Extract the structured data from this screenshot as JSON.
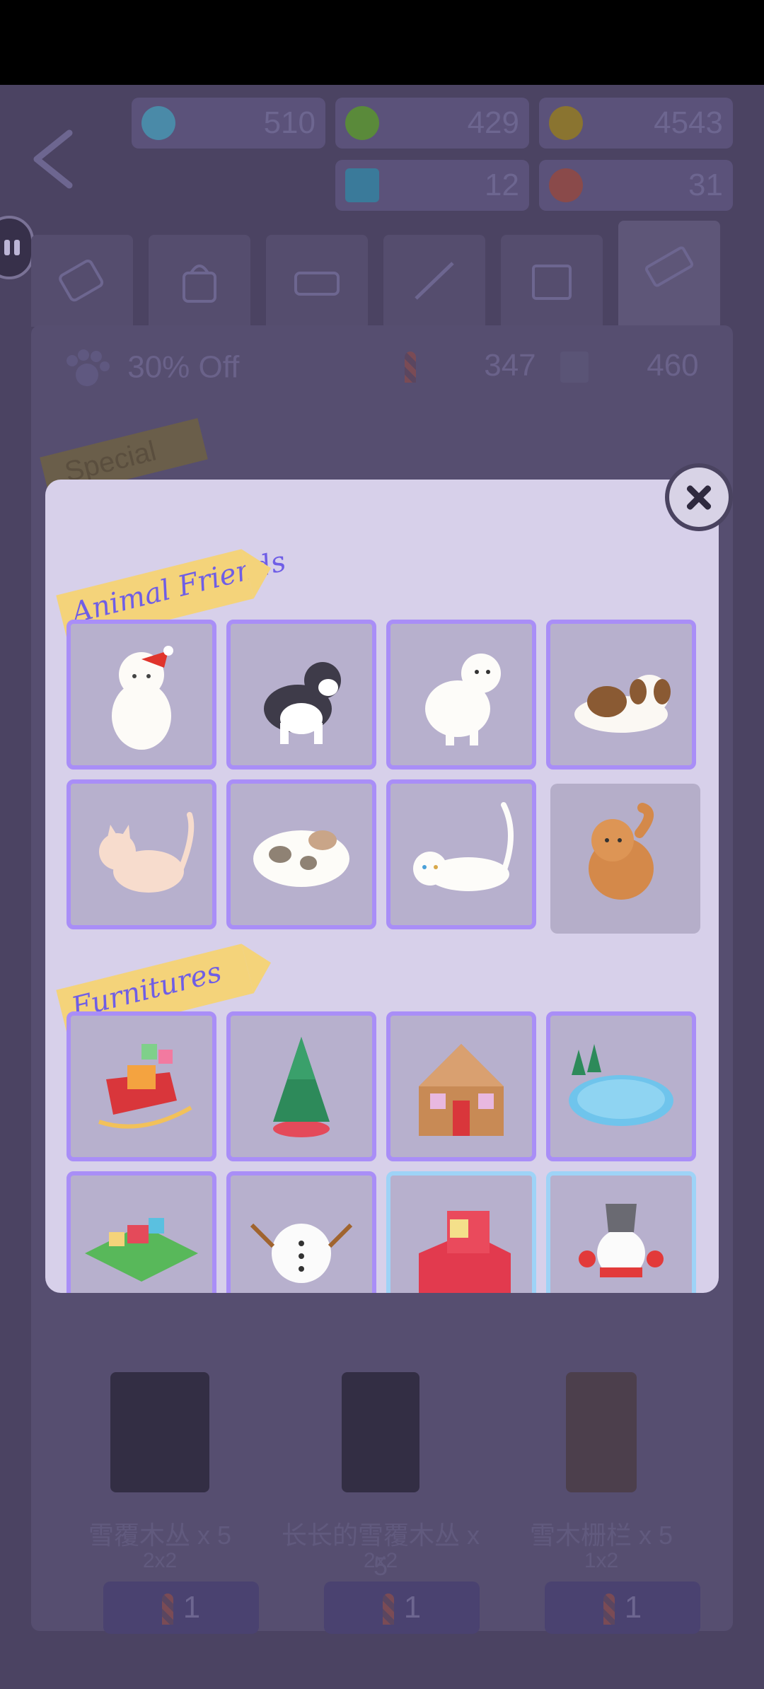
{
  "currencies": [
    {
      "name": "r-coin",
      "icon": "R",
      "value": "510"
    },
    {
      "name": "clover",
      "icon": "clover",
      "value": "429"
    },
    {
      "name": "gold-coin",
      "icon": "coin",
      "value": "4543"
    },
    {
      "name": "ticket",
      "icon": "ticket",
      "value": "12"
    },
    {
      "name": "heart",
      "icon": "heart",
      "value": "31"
    }
  ],
  "shop": {
    "discount": "30% Off",
    "candy_cane_count": "347",
    "ticket_count": "460",
    "special_label": "Special box",
    "items": [
      {
        "label": "雪覆木丛 x 5",
        "size": "2x2",
        "price": "1"
      },
      {
        "label": "长长的雪覆木丛 x 5",
        "size": "2x2",
        "price": "1"
      },
      {
        "label": "雪木栅栏 x 5",
        "size": "1x2",
        "price": "1"
      }
    ]
  },
  "modal": {
    "sections": [
      {
        "title": "Animal Friends",
        "tiles": [
          "white-cat-santa-hat",
          "husky-dog",
          "samoyed-dog",
          "shih-tzu-dog",
          "peach-cat",
          "calico-cat",
          "white-cat-lying",
          "pomeranian-dog"
        ]
      },
      {
        "title": "Furnitures",
        "tiles": [
          "red-sleigh",
          "christmas-tree",
          "gingerbread-house",
          "ice-rink",
          "gift-garden",
          "snowman-body",
          "red-armchair",
          "snowman-bucket-hat"
        ]
      }
    ]
  },
  "colors": {
    "accent": "#a98ef7",
    "ribbon": "#f4d37a",
    "ribbon_text": "#6f5ee6",
    "modal_bg": "#d7d0ea"
  }
}
